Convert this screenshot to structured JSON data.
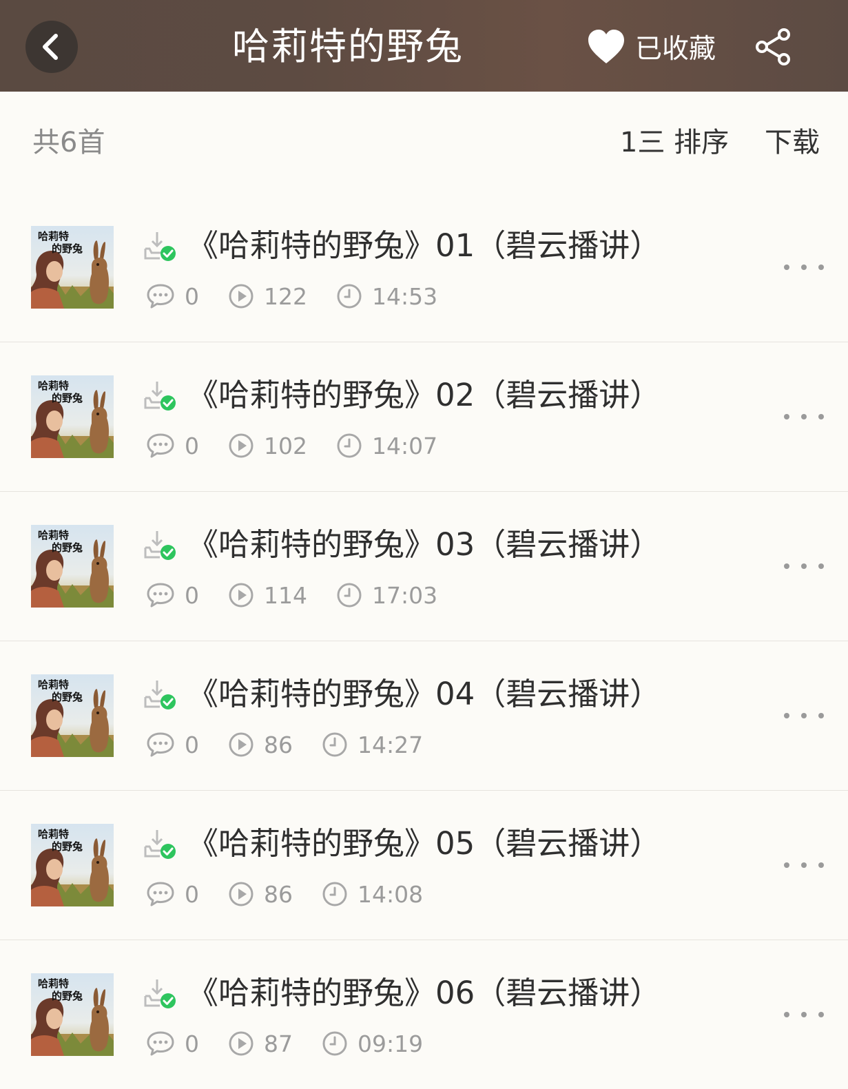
{
  "header": {
    "title": "哈莉特的野兔",
    "favorite_label": "已收藏"
  },
  "toolbar": {
    "count_label": "共6首",
    "sort_label": "1三 排序",
    "download_label": "下载"
  },
  "cover": {
    "text_line1": "哈莉特",
    "text_line2": "的野兔"
  },
  "episodes": [
    {
      "title": "《哈莉特的野兔》01（碧云播讲）",
      "comments": "0",
      "plays": "122",
      "duration": "14:53"
    },
    {
      "title": "《哈莉特的野兔》02（碧云播讲）",
      "comments": "0",
      "plays": "102",
      "duration": "14:07"
    },
    {
      "title": "《哈莉特的野兔》03（碧云播讲）",
      "comments": "0",
      "plays": "114",
      "duration": "17:03"
    },
    {
      "title": "《哈莉特的野兔》04（碧云播讲）",
      "comments": "0",
      "plays": "86",
      "duration": "14:27"
    },
    {
      "title": "《哈莉特的野兔》05（碧云播讲）",
      "comments": "0",
      "plays": "86",
      "duration": "14:08"
    },
    {
      "title": "《哈莉特的野兔》06（碧云播讲）",
      "comments": "0",
      "plays": "87",
      "duration": "09:19"
    }
  ],
  "icons": {
    "back": "chevron-left-icon",
    "favorite": "heart-icon",
    "share": "share-icon",
    "downloaded": "downloaded-check-icon",
    "comments": "comment-bubble-icon",
    "plays": "play-circle-icon",
    "duration": "clock-icon",
    "more": "more-dots-icon"
  },
  "colors": {
    "header_bg": "#5d4b42",
    "page_bg": "#fcfbf7",
    "downloaded_check": "#2ec55e",
    "meta_gray": "#9b9b9b"
  }
}
